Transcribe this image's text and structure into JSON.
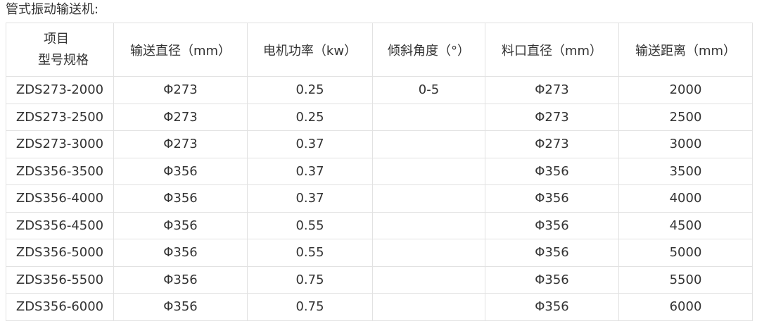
{
  "title": "管式振动输送机:",
  "table": {
    "header": {
      "corner_top": "项目",
      "corner_bottom": "型号规格",
      "columns": [
        "输送直径（mm）",
        "电机功率（kw）",
        "倾斜角度（°）",
        "料口直径（mm）",
        "输送距离（mm）"
      ]
    },
    "rows": [
      [
        "ZDS273-2000",
        "Φ273",
        "0.25",
        "0-5",
        "Φ273",
        "2000"
      ],
      [
        "ZDS273-2500",
        "Φ273",
        "0.25",
        "",
        "Φ273",
        "2500"
      ],
      [
        "ZDS273-3000",
        "Φ273",
        "0.37",
        "",
        "Φ273",
        "3000"
      ],
      [
        "ZDS356-3500",
        "Φ356",
        "0.37",
        "",
        "Φ356",
        "3500"
      ],
      [
        "ZDS356-4000",
        "Φ356",
        "0.37",
        "",
        "Φ356",
        "4000"
      ],
      [
        "ZDS356-4500",
        "Φ356",
        "0.55",
        "",
        "Φ356",
        "4500"
      ],
      [
        "ZDS356-5000",
        "Φ356",
        "0.55",
        "",
        "Φ356",
        "5000"
      ],
      [
        "ZDS356-5500",
        "Φ356",
        "0.75",
        "",
        "Φ356",
        "5500"
      ],
      [
        "ZDS356-6000",
        "Φ356",
        "0.75",
        "",
        "Φ356",
        "6000"
      ]
    ]
  }
}
